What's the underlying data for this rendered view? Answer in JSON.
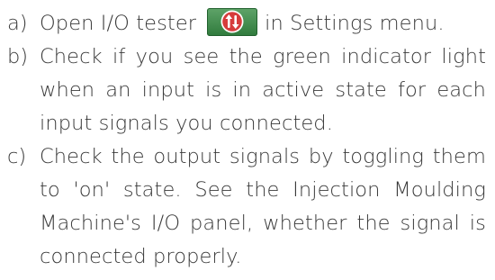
{
  "steps": [
    {
      "letter": "a)",
      "text_before_icon": "Open I/O tester",
      "icon": "io-tester-icon",
      "text_after_icon": "in Settings menu."
    },
    {
      "letter": "b)",
      "text": "Check if you see the green indicator light when an input is in active state for each input signals you connected."
    },
    {
      "letter": "c)",
      "text": "Check the output signals by toggling them to 'on' state. See the Injection Moulding Machine's I/O panel, whether the signal is connected properly."
    }
  ],
  "colors": {
    "text": "#3a3a3a",
    "icon_green": "#3d8a48",
    "icon_red": "#d63b3b"
  }
}
